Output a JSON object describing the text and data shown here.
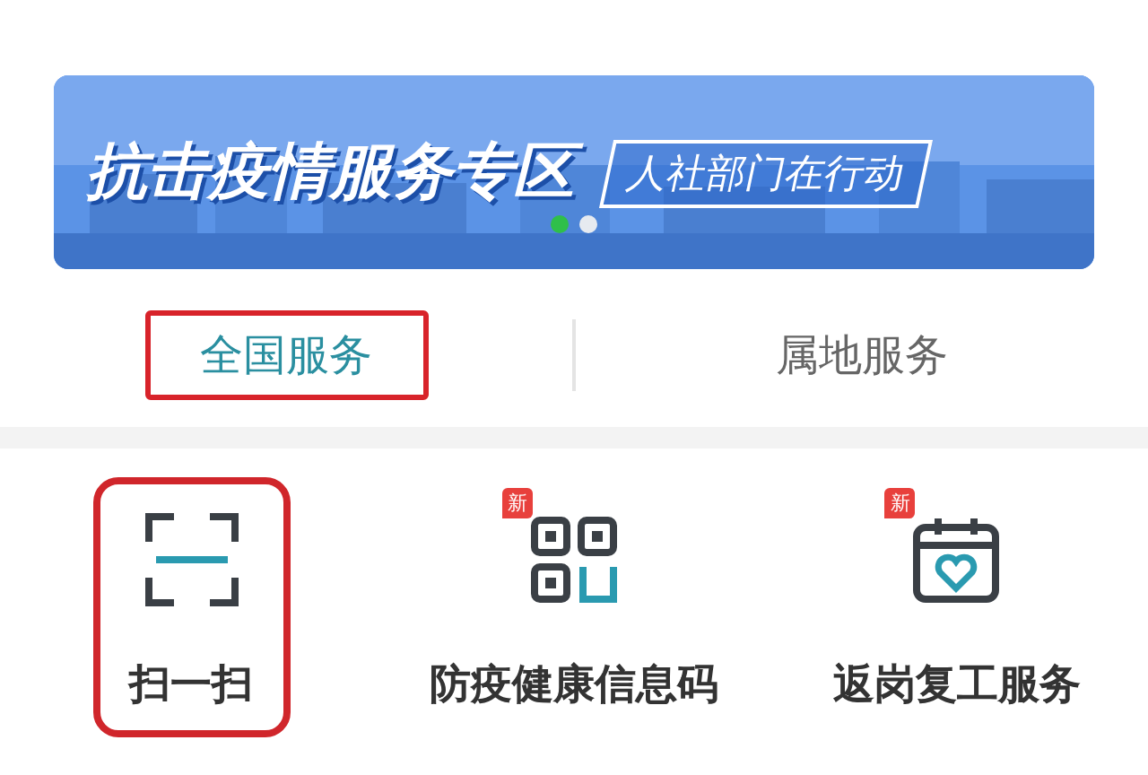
{
  "banner": {
    "title": "抗击疫情服务专区",
    "subtitle": "人社部门在行动",
    "dots": [
      {
        "selected": true
      },
      {
        "selected": false
      }
    ]
  },
  "tabs": [
    {
      "label": "全国服务",
      "selected": true,
      "highlighted": true
    },
    {
      "label": "属地服务",
      "selected": false,
      "highlighted": false
    }
  ],
  "services": [
    {
      "label": "扫一扫",
      "kind": "scan",
      "highlighted": true
    },
    {
      "label": "防疫健康信息码",
      "kind": "qrcode",
      "badge": "新",
      "highlighted": false
    },
    {
      "label": "返岗复工服务",
      "kind": "calendar",
      "badge": "新",
      "highlighted": false
    }
  ]
}
